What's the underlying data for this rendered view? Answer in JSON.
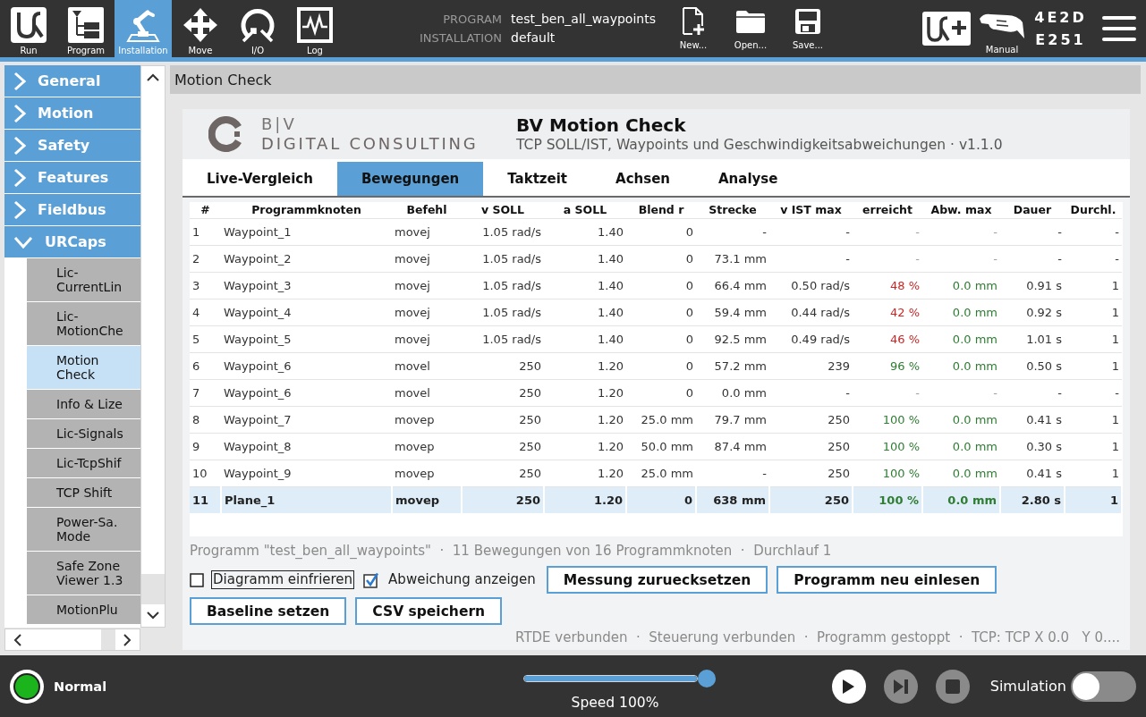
{
  "top_bar": {
    "nav": [
      {
        "kind": "run",
        "label": "Run",
        "selected": false
      },
      {
        "kind": "program",
        "label": "Program",
        "selected": false
      },
      {
        "kind": "installation",
        "label": "Installation",
        "selected": true
      },
      {
        "kind": "move",
        "label": "Move",
        "selected": false
      },
      {
        "kind": "io",
        "label": "I/O",
        "selected": false
      },
      {
        "kind": "log",
        "label": "Log",
        "selected": false
      }
    ],
    "program": {
      "label": "PROGRAM",
      "value": "test_ben_all_waypoints"
    },
    "installation": {
      "label": "INSTALLATION",
      "value": "default"
    },
    "file_actions": [
      {
        "kind": "new",
        "label": "New..."
      },
      {
        "kind": "open",
        "label": "Open..."
      },
      {
        "kind": "save",
        "label": "Save..."
      }
    ],
    "mode": {
      "label": "Manual"
    },
    "serial": [
      "4E2D",
      "E251"
    ]
  },
  "sidebar": {
    "items": [
      {
        "label": "General",
        "expanded": false
      },
      {
        "label": "Motion",
        "expanded": false
      },
      {
        "label": "Safety",
        "expanded": false
      },
      {
        "label": "Features",
        "expanded": false
      },
      {
        "label": "Fieldbus",
        "expanded": false
      },
      {
        "label": "URCaps",
        "expanded": true,
        "children": [
          {
            "label": "Lic-CurrentLin",
            "selected": false
          },
          {
            "label": "Lic-MotionChe",
            "selected": false
          },
          {
            "label": "Motion Check",
            "selected": true
          },
          {
            "label": "Info & Lize",
            "selected": false
          },
          {
            "label": "Lic-Signals",
            "selected": false
          },
          {
            "label": "Lic-TcpShif",
            "selected": false
          },
          {
            "label": "TCP Shift",
            "selected": false
          },
          {
            "label": "Power-Sa. Mode",
            "selected": false
          },
          {
            "label": "Safe Zone Viewer 1.3",
            "selected": false
          },
          {
            "label": "MotionPlu",
            "selected": false
          }
        ]
      }
    ]
  },
  "panel": {
    "title": "Motion Check",
    "banner": {
      "logo_mark": "B|V",
      "logo_name": "DIGITAL CONSULTING",
      "title": "BV Motion Check",
      "subtitle": "TCP SOLL/IST, Waypoints und Geschwindigkeitsabweichungen · v1.1.0"
    },
    "tabs": [
      {
        "label": "Live-Vergleich",
        "selected": false
      },
      {
        "label": "Bewegungen",
        "selected": true
      },
      {
        "label": "Taktzeit",
        "selected": false
      },
      {
        "label": "Achsen",
        "selected": false
      },
      {
        "label": "Analyse",
        "selected": false
      }
    ],
    "table": {
      "columns": [
        "#",
        "Programmknoten",
        "Befehl",
        "v SOLL",
        "a SOLL",
        "Blend r",
        "Strecke",
        "v IST max",
        "erreicht",
        "Abw. max",
        "Dauer",
        "Durchl."
      ],
      "rows": [
        {
          "kind": "move",
          "measured": false,
          "below_target": false,
          "cells": [
            "1",
            "Waypoint_1",
            "movej",
            "1.05 rad/s",
            "1.40",
            "0",
            "-",
            "-",
            "-",
            "-",
            "-",
            "-"
          ]
        },
        {
          "kind": "move",
          "measured": false,
          "below_target": false,
          "cells": [
            "2",
            "Waypoint_2",
            "movej",
            "1.05 rad/s",
            "1.40",
            "0",
            "73.1 mm",
            "-",
            "-",
            "-",
            "-",
            "-"
          ]
        },
        {
          "kind": "move",
          "measured": true,
          "below_target": true,
          "cells": [
            "3",
            "Waypoint_3",
            "movej",
            "1.05 rad/s",
            "1.40",
            "0",
            "66.4 mm",
            "0.50 rad/s",
            "48 %",
            "0.0 mm",
            "0.91 s",
            "1"
          ]
        },
        {
          "kind": "move",
          "measured": true,
          "below_target": true,
          "cells": [
            "4",
            "Waypoint_4",
            "movej",
            "1.05 rad/s",
            "1.40",
            "0",
            "59.4 mm",
            "0.44 rad/s",
            "42 %",
            "0.0 mm",
            "0.92 s",
            "1"
          ]
        },
        {
          "kind": "move",
          "measured": true,
          "below_target": true,
          "cells": [
            "5",
            "Waypoint_5",
            "movej",
            "1.05 rad/s",
            "1.40",
            "0",
            "92.5 mm",
            "0.49 rad/s",
            "46 %",
            "0.0 mm",
            "1.01 s",
            "1"
          ]
        },
        {
          "kind": "move",
          "measured": true,
          "below_target": false,
          "cells": [
            "6",
            "Waypoint_6",
            "movel",
            "250",
            "1.20",
            "0",
            "57.2 mm",
            "239",
            "96 %",
            "0.0 mm",
            "0.50 s",
            "1"
          ]
        },
        {
          "kind": "move",
          "measured": false,
          "below_target": false,
          "cells": [
            "7",
            "Waypoint_6",
            "movel",
            "250",
            "1.20",
            "0",
            "0.0 mm",
            "-",
            "-",
            "-",
            "-",
            "-"
          ]
        },
        {
          "kind": "move",
          "measured": true,
          "below_target": false,
          "cells": [
            "8",
            "Waypoint_7",
            "movep",
            "250",
            "1.20",
            "25.0 mm",
            "79.7 mm",
            "250",
            "100 %",
            "0.0 mm",
            "0.41 s",
            "1"
          ]
        },
        {
          "kind": "move",
          "measured": true,
          "below_target": false,
          "cells": [
            "9",
            "Waypoint_8",
            "movep",
            "250",
            "1.20",
            "50.0 mm",
            "87.4 mm",
            "250",
            "100 %",
            "0.0 mm",
            "0.30 s",
            "1"
          ]
        },
        {
          "kind": "move",
          "measured": true,
          "below_target": false,
          "cells": [
            "10",
            "Waypoint_9",
            "movep",
            "250",
            "1.20",
            "25.0 mm",
            "-",
            "250",
            "100 %",
            "0.0 mm",
            "0.41 s",
            "1"
          ]
        },
        {
          "kind": "summary",
          "measured": true,
          "below_target": false,
          "cells": [
            "11",
            "Plane_1",
            "movep",
            "250",
            "1.20",
            "0",
            "638 mm",
            "250",
            "100 %",
            "0.0 mm",
            "2.80 s",
            "1"
          ]
        }
      ]
    },
    "summary": "Programm \"test_ben_all_waypoints\"  ·  11 Bewegungen von 16 Programmknoten  ·  Durchlauf 1",
    "options": [
      {
        "label": "Diagramm einfrieren",
        "checked": false,
        "focused": true
      },
      {
        "label": "Abweichung anzeigen",
        "checked": true,
        "focused": false
      }
    ],
    "buttons": [
      "Messung zuruecksetzen",
      "Programm neu einlesen",
      "Baseline setzen",
      "CSV speichern"
    ],
    "status": "RTDE verbunden  ·  Steuerung verbunden  ·  Programm gestoppt  ·  TCP: TCP X 0.0   Y 0...."
  },
  "bottom_bar": {
    "robot_status": {
      "label": "Normal",
      "color": "#1cb41c"
    },
    "speed": {
      "label": "Speed 100%",
      "level": 1
    },
    "controls": [
      {
        "kind": "play",
        "disabled": false
      },
      {
        "kind": "step",
        "disabled": true
      },
      {
        "kind": "stop",
        "disabled": true
      }
    ],
    "simulation": {
      "label": "Simulation",
      "on": false
    }
  }
}
